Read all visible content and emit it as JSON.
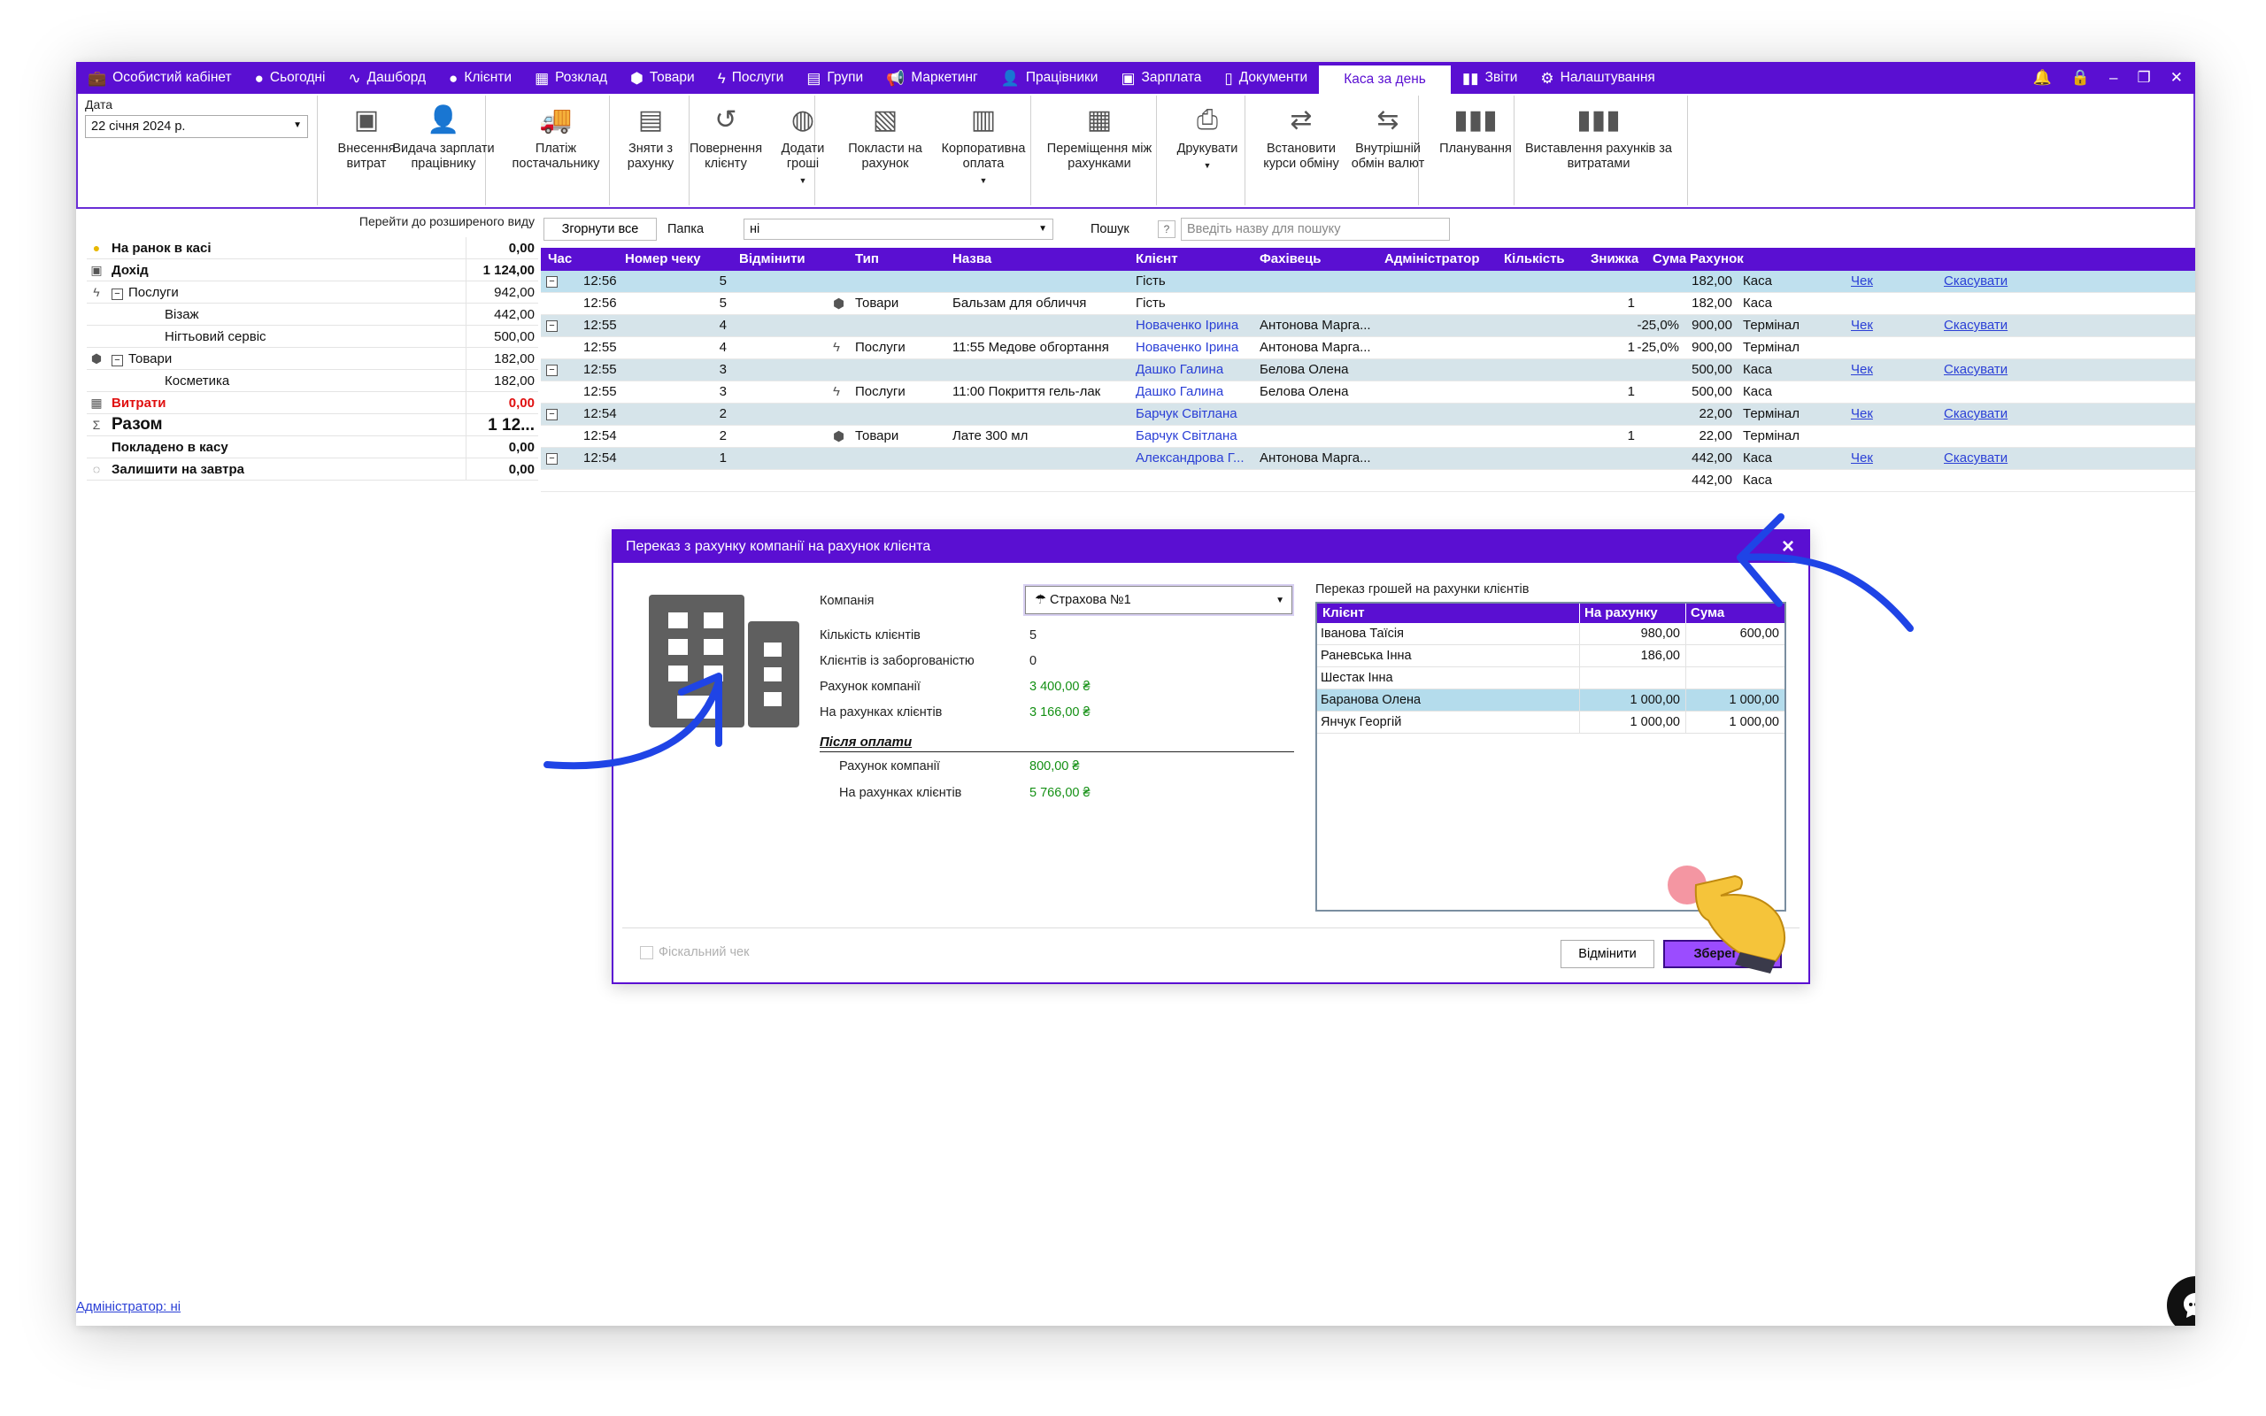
{
  "menu": {
    "items": [
      {
        "label": "Особистий кабінет",
        "icon": "briefcase-icon"
      },
      {
        "label": "Сьогодні",
        "icon": "today-icon"
      },
      {
        "label": "Дашборд",
        "icon": "pulse-icon"
      },
      {
        "label": "Клієнти",
        "icon": "user-circle-icon"
      },
      {
        "label": "Розклад",
        "icon": "calendar-icon"
      },
      {
        "label": "Товари",
        "icon": "box-icon"
      },
      {
        "label": "Послуги",
        "icon": "lightning-icon"
      },
      {
        "label": "Групи",
        "icon": "groups-icon"
      },
      {
        "label": "Маркетинг",
        "icon": "megaphone-icon"
      },
      {
        "label": "Працівники",
        "icon": "person-icon"
      },
      {
        "label": "Зарплата",
        "icon": "money-icon"
      },
      {
        "label": "Документи",
        "icon": "document-icon"
      },
      {
        "label": "Каса за день",
        "icon": "",
        "active": true
      },
      {
        "label": "Звіти",
        "icon": "bar-chart-icon"
      },
      {
        "label": "Налаштування",
        "icon": "gear-icon"
      }
    ]
  },
  "ribbon": {
    "date_label": "Дата",
    "date_value": "22 січня 2024 р.",
    "buttons": [
      {
        "label": "Внесення витрат",
        "icon": "cash-icon"
      },
      {
        "label": "Видача зарплати працівнику",
        "icon": "pay-employee-icon"
      },
      {
        "label": "Платіж постачальнику",
        "icon": "truck-icon"
      },
      {
        "label": "Зняти з рахунку",
        "icon": "safe-icon"
      },
      {
        "label": "Повернення клієнту",
        "icon": "refund-icon"
      },
      {
        "label": "Додати гроші",
        "icon": "coins-icon"
      },
      {
        "label": "Покласти на рахунок",
        "icon": "deposit-box-icon"
      },
      {
        "label": "Корпоративна оплата",
        "icon": "building-icon"
      },
      {
        "label": "Переміщення між рахунками",
        "icon": "calculator-icon"
      },
      {
        "label": "Друкувати",
        "icon": "printer-icon"
      },
      {
        "label": "Встановити курси обміну",
        "icon": "exchange-rate-icon"
      },
      {
        "label": "Внутрішній обмін валют",
        "icon": "currency-swap-icon"
      },
      {
        "label": "Планування",
        "icon": "planning-chart-icon"
      },
      {
        "label": "Виставлення рахунків за витратами",
        "icon": "invoice-chart-icon"
      }
    ]
  },
  "summary": {
    "advanced_link": "Перейти до розширеного виду",
    "rows": [
      {
        "label": "На ранок в касі",
        "value": "0,00"
      },
      {
        "label": "Дохід",
        "value": "1 124,00"
      },
      {
        "label": "Послуги",
        "value": "942,00"
      },
      {
        "label": "Візаж",
        "value": "442,00"
      },
      {
        "label": "Нігтьовий сервіс",
        "value": "500,00"
      },
      {
        "label": "Товари",
        "value": "182,00"
      },
      {
        "label": "Косметика",
        "value": "182,00"
      },
      {
        "label": "Витрати",
        "value": "0,00"
      },
      {
        "label": "Разом",
        "value": "1 12..."
      },
      {
        "label": "Покладено в касу",
        "value": "0,00"
      },
      {
        "label": "Залишити на завтра",
        "value": "0,00"
      }
    ]
  },
  "toolbar": {
    "collapse_label": "Згорнути все",
    "folder_label": "Папка",
    "folder_value": "ні",
    "search_label": "Пошук",
    "search_help": "?",
    "search_placeholder": "Введіть назву для пошуку"
  },
  "grid": {
    "columns": [
      "Час",
      "Номер чеку",
      "Відмінити",
      "Тип",
      "Назва",
      "Клієнт",
      "Фахівець",
      "Адміністратор",
      "Кількість",
      "Знижка",
      "Сума",
      "Рахунок"
    ],
    "rows": [
      {
        "time": "12:56",
        "num": "5",
        "type": "",
        "name": "",
        "client": "Гість",
        "master": "",
        "qty": "",
        "disc": "",
        "sum": "182,00",
        "acc": "Каса",
        "check": "Чек",
        "cancel": "Скасувати"
      },
      {
        "time": "12:56",
        "num": "5",
        "type": "Товари",
        "name": "Бальзам для обличчя",
        "client": "Гість",
        "master": "",
        "qty": "1",
        "disc": "",
        "sum": "182,00",
        "acc": "Каса",
        "check": "",
        "cancel": ""
      },
      {
        "time": "12:55",
        "num": "4",
        "type": "",
        "name": "",
        "client": "Новаченко Ірина",
        "master": "Антонова Марга...",
        "qty": "",
        "disc": "-25,0%",
        "sum": "900,00",
        "acc": "Термінал",
        "check": "Чек",
        "cancel": "Скасувати"
      },
      {
        "time": "12:55",
        "num": "4",
        "type": "Послуги",
        "name": "11:55 Медове обгортання",
        "client": "Новаченко Ірина",
        "master": "Антонова Марга...",
        "qty": "1",
        "disc": "-25,0%",
        "sum": "900,00",
        "acc": "Термінал",
        "check": "",
        "cancel": ""
      },
      {
        "time": "12:55",
        "num": "3",
        "type": "",
        "name": "",
        "client": "Дашко Галина",
        "master": "Белова Олена",
        "qty": "",
        "disc": "",
        "sum": "500,00",
        "acc": "Каса",
        "check": "Чек",
        "cancel": "Скасувати"
      },
      {
        "time": "12:55",
        "num": "3",
        "type": "Послуги",
        "name": "11:00 Покриття гель-лак",
        "client": "Дашко Галина",
        "master": "Белова Олена",
        "qty": "1",
        "disc": "",
        "sum": "500,00",
        "acc": "Каса",
        "check": "",
        "cancel": ""
      },
      {
        "time": "12:54",
        "num": "2",
        "type": "",
        "name": "",
        "client": "Барчук Світлана",
        "master": "",
        "qty": "",
        "disc": "",
        "sum": "22,00",
        "acc": "Термінал",
        "check": "Чек",
        "cancel": "Скасувати"
      },
      {
        "time": "12:54",
        "num": "2",
        "type": "Товари",
        "name": "Лате 300 мл",
        "client": "Барчук Світлана",
        "master": "",
        "qty": "1",
        "disc": "",
        "sum": "22,00",
        "acc": "Термінал",
        "check": "",
        "cancel": ""
      },
      {
        "time": "12:54",
        "num": "1",
        "type": "",
        "name": "",
        "client": "Александрова Г...",
        "master": "Антонова Марга...",
        "qty": "",
        "disc": "",
        "sum": "442,00",
        "acc": "Каса",
        "check": "Чек",
        "cancel": "Скасувати"
      },
      {
        "time": "",
        "num": "",
        "type": "",
        "name": "",
        "client": "",
        "master": "",
        "qty": "",
        "disc": "",
        "sum": "442,00",
        "acc": "Каса",
        "check": "",
        "cancel": ""
      }
    ]
  },
  "dialog": {
    "title": "Переказ з рахунку компанії на рахунок клієнта",
    "company_label": "Компанія",
    "company_value": "Страхова №1",
    "clients_count_label": "Кількість клієнтів",
    "clients_count": "5",
    "debt_clients_label": "Клієнтів із заборгованістю",
    "debt_clients": "0",
    "company_account_label": "Рахунок компанії",
    "company_account": "3 400,00 ₴",
    "client_accounts_label": "На рахунках клієнтів",
    "client_accounts": "3 166,00 ₴",
    "after_title": "Після оплати",
    "after_company_label": "Рахунок компанії",
    "after_company": "800,00 ₴",
    "after_clients_label": "На рахунках клієнтів",
    "after_clients": "5 766,00 ₴",
    "transfer_title": "Переказ грошей на рахунки клієнтів",
    "table_columns": [
      "Клієнт",
      "На рахунку",
      "Сума"
    ],
    "table_rows": [
      {
        "client": "Іванова Таїсія",
        "balance": "980,00",
        "amount": "600,00"
      },
      {
        "client": "Раневська Інна",
        "balance": "186,00",
        "amount": ""
      },
      {
        "client": "Шестак Інна",
        "balance": "",
        "amount": ""
      },
      {
        "client": "Баранова Олена",
        "balance": "1 000,00",
        "amount": "1 000,00"
      },
      {
        "client": "Янчук Георгій",
        "balance": "1 000,00",
        "amount": "1 000,00"
      }
    ],
    "fiscal_label": "Фіскальний чек",
    "cancel_label": "Відмінити",
    "save_label": "Зберегти"
  },
  "footer": {
    "admin_link": "Адміністратор: ні"
  },
  "colors": {
    "accent": "#5a0fd2",
    "positive": "#149014",
    "negative": "#e01010",
    "link": "#2a3fd6",
    "arrow": "#1f44e6"
  }
}
